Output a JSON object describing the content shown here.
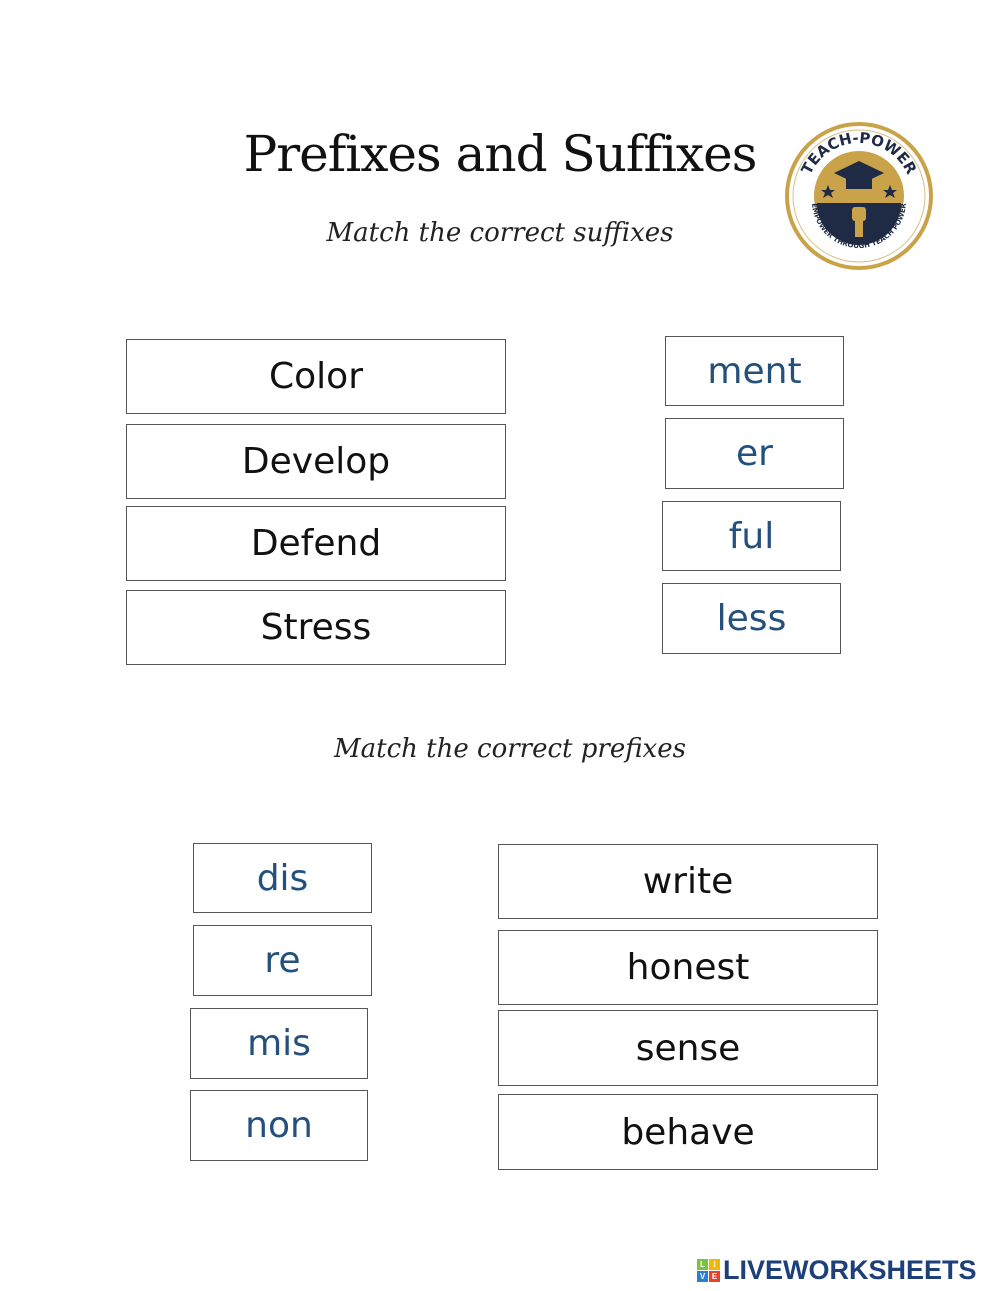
{
  "header": {
    "title": "Prefixes and Suffixes",
    "logo": {
      "name": "teach-power-logo",
      "top_text": "TEACH-POWER",
      "bottom_text": "EMPOWER THROUGH TEACH POWER",
      "colors": {
        "gold": "#c9a24a",
        "navy": "#1f2b45"
      }
    }
  },
  "suffix_section": {
    "instruction": "Match the correct suffixes",
    "words": [
      "Color",
      "Develop",
      "Defend",
      "Stress"
    ],
    "suffixes": [
      "ment",
      "er",
      "ful",
      "less"
    ]
  },
  "prefix_section": {
    "instruction": "Match the correct prefixes",
    "prefixes": [
      "dis",
      "re",
      "mis",
      "non"
    ],
    "words": [
      "write",
      "honest",
      "sense",
      "behave"
    ]
  },
  "footer": {
    "brand": "LIVEWORKSHEETS",
    "badge_letters": [
      "L",
      "I",
      "V",
      "E"
    ],
    "badge_colors": [
      "#7cc242",
      "#f5b800",
      "#2b7fd0",
      "#e8412c"
    ]
  },
  "colors": {
    "affix_text": "#24507e",
    "word_text": "#111111",
    "card_border": "#555555"
  }
}
